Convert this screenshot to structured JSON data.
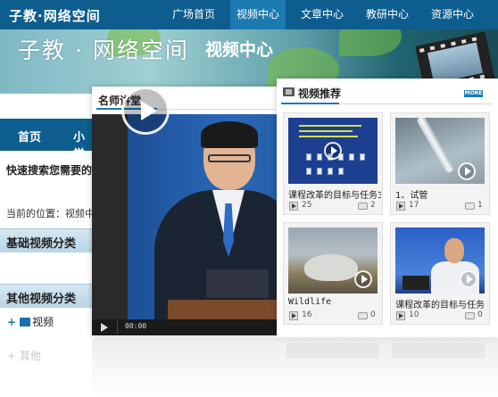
{
  "top_bar": {
    "site_title": "子教·网络空间",
    "nav": [
      "广场首页",
      "视频中心",
      "文章中心",
      "教研中心",
      "资源中心"
    ],
    "active_nav": "视频中心"
  },
  "banner": {
    "title": "子教 · 网络空间",
    "subtitle": "视频中心"
  },
  "left_page": {
    "nav": [
      "首页",
      "小学"
    ],
    "search_text": "快速搜索您需要的视",
    "location_label": "当前的位置：",
    "location_value": "视频中",
    "section_basic": "基础视频分类",
    "section_other": "其他视频分类",
    "tree_item": "视频",
    "ghost_item": "其他"
  },
  "lecture_panel": {
    "heading": "名师讲堂",
    "player_time": "00:00"
  },
  "recommend_panel": {
    "heading": "视频推荐",
    "more_label": "MORE",
    "cards": [
      {
        "title": "课程改革的目标与任务3",
        "views": "25",
        "comments": "2"
      },
      {
        "title": "1、试管",
        "views": "17",
        "comments": "1"
      },
      {
        "title": "Wildlife",
        "views": "16",
        "comments": "0"
      },
      {
        "title": "课程改革的目标与任务",
        "views": "10",
        "comments": "0"
      }
    ]
  },
  "colors": {
    "nav_blue": "#0d5d8e",
    "accent_blue": "#1b7ab0",
    "more_badge": "#1b7ab0"
  },
  "icons": [
    "film-icon",
    "play-icon",
    "comment-icon",
    "folder-icon",
    "plus-icon"
  ]
}
